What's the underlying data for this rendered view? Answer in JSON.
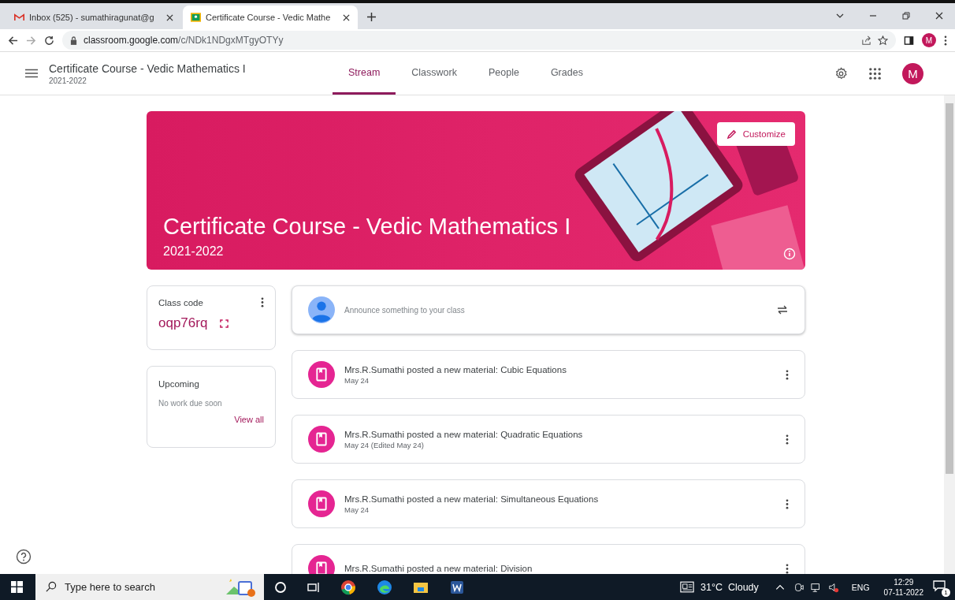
{
  "browser": {
    "tabs": [
      {
        "title": "Inbox (525) - sumathiragunat@g",
        "selected": false,
        "kind": "mail"
      },
      {
        "title": "Certificate Course - Vedic Mathe",
        "selected": true,
        "kind": "classroom"
      }
    ],
    "url_host": "classroom.google.com",
    "url_path": "/c/NDk1NDgxMTgyOTYy",
    "profile_letter": "M"
  },
  "app": {
    "course_title": "Certificate Course - Vedic Mathematics I",
    "course_year": "2021-2022",
    "nav": [
      {
        "label": "Stream",
        "selected": true
      },
      {
        "label": "Classwork",
        "selected": false
      },
      {
        "label": "People",
        "selected": false
      },
      {
        "label": "Grades",
        "selected": false
      }
    ],
    "avatar_letter": "M"
  },
  "banner": {
    "title": "Certificate Course - Vedic Mathematics I",
    "year": "2021-2022",
    "customize_label": "Customize"
  },
  "class_code": {
    "label": "Class code",
    "code": "oqp76rq"
  },
  "upcoming": {
    "title": "Upcoming",
    "message": "No work due soon",
    "link": "View all"
  },
  "announce": {
    "placeholder": "Announce something to your class"
  },
  "posts": [
    {
      "title": "Mrs.R.Sumathi posted a new material: Cubic Equations",
      "date": "May 24"
    },
    {
      "title": "Mrs.R.Sumathi posted a new material: Quadratic Equations",
      "date": "May 24 (Edited May 24)"
    },
    {
      "title": "Mrs.R.Sumathi posted a new material: Simultaneous Equations",
      "date": "May 24"
    },
    {
      "title": "Mrs.R.Sumathi posted a new material: Division"
    }
  ],
  "taskbar": {
    "search_placeholder": "Type here to search",
    "weather": "31°C  Cloudy",
    "language": "ENG",
    "time": "12:29",
    "date": "07-11-2022",
    "notification_count": "1"
  }
}
